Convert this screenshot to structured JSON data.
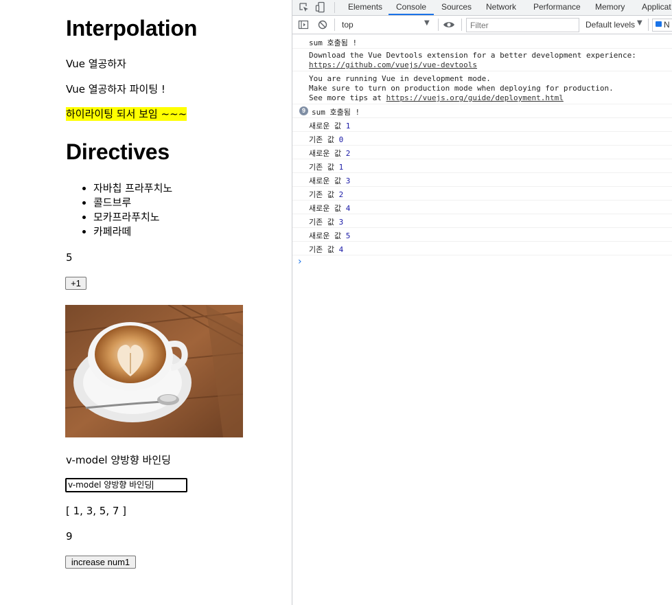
{
  "page": {
    "interpolation_title": "Interpolation",
    "message": "Vue 열공하자",
    "message_fighting": "Vue 열공하자 파이팅 !",
    "highlight_text": "하이라이팅 되서 보임 ~~~",
    "directives_title": "Directives",
    "menu_items": [
      "자바칩 프라푸치노",
      "콜드브루",
      "모카프라푸치노",
      "카페라떼"
    ],
    "count": "5",
    "plus_button_label": "+1",
    "image_icon": "latte-art-coffee-cup-photo",
    "vmodel_text": "v-model 양방향 바인딩",
    "vmodel_input_value": "v-model 양방향 바인딩",
    "array_text": "[ 1, 3, 5, 7 ]",
    "sum_value": "9",
    "increase_button_label": "increase num1"
  },
  "devtools": {
    "tabs": [
      "Elements",
      "Console",
      "Sources",
      "Network",
      "Performance",
      "Memory",
      "Applicat"
    ],
    "active_tab": "Console",
    "context_select": "top",
    "filter_placeholder": "Filter",
    "levels_label": "Default levels",
    "issues_label": "N",
    "console_lines": [
      {
        "text": "sum 호출됨 !"
      },
      {
        "line1": "Download the Vue Devtools extension for a better development experience:",
        "link": "https://github.com/vuejs/vue-devtools"
      },
      {
        "line1": "You are running Vue in development mode.",
        "line2": "Make sure to turn on production mode when deploying for production.",
        "line3_prefix": "See more tips at ",
        "link": "https://vuejs.org/guide/deployment.html"
      },
      {
        "badge": "9",
        "text": "sum 호출됨 !"
      }
    ],
    "value_logs": [
      {
        "label": "새로운 값",
        "value": "1"
      },
      {
        "label": "기존 값",
        "value": "0"
      },
      {
        "label": "새로운 값",
        "value": "2"
      },
      {
        "label": "기존 값",
        "value": "1"
      },
      {
        "label": "새로운 값",
        "value": "3"
      },
      {
        "label": "기존 값",
        "value": "2"
      },
      {
        "label": "새로운 값",
        "value": "4"
      },
      {
        "label": "기존 값",
        "value": "3"
      },
      {
        "label": "새로운 값",
        "value": "5"
      },
      {
        "label": "기존 값",
        "value": "4"
      }
    ],
    "prompt": "›",
    "accent_color": "#1a73e8"
  }
}
